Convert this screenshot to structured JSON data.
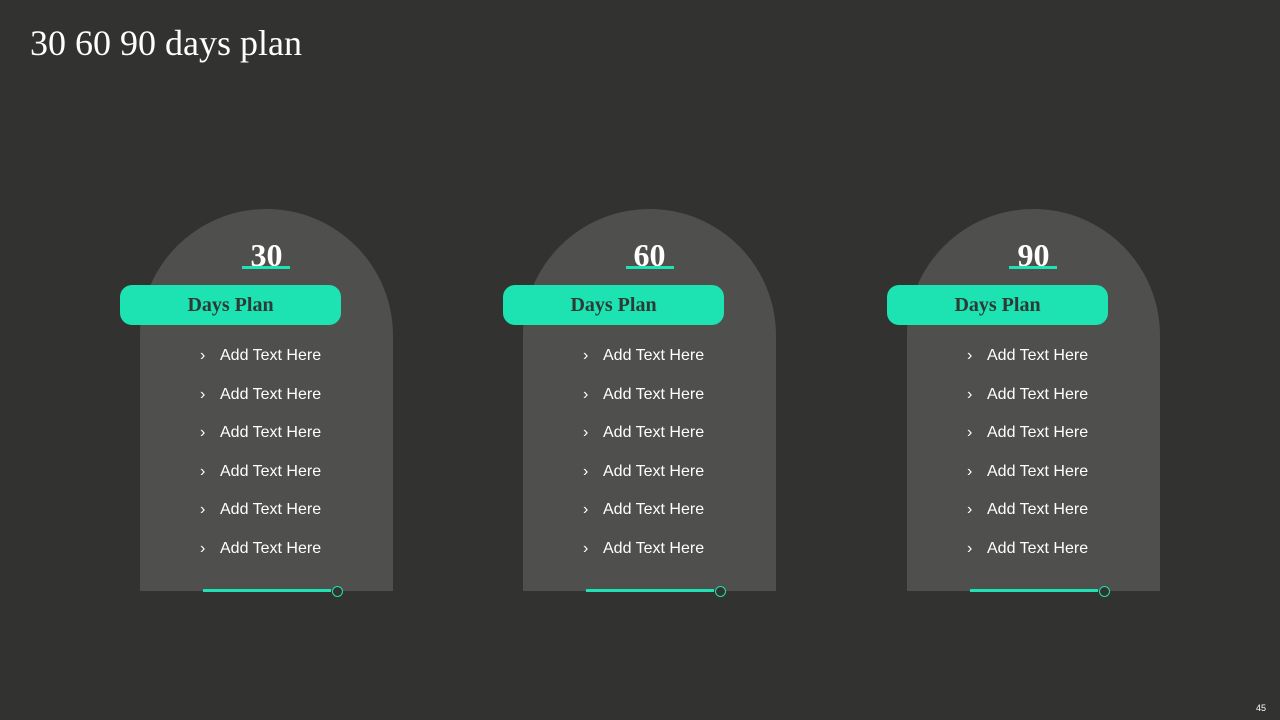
{
  "title": "30 60 90 days plan",
  "page_number": "45",
  "colors": {
    "background": "#323230",
    "card": "#4f4f4d",
    "accent": "#1de2b2",
    "pill_text": "#2d3a36"
  },
  "icons": {
    "bullet": "chevron-right-icon"
  },
  "cards": [
    {
      "number": "30",
      "label": "Days Plan",
      "items": [
        "Add Text Here",
        "Add Text Here",
        "Add Text Here",
        "Add Text Here",
        "Add Text Here",
        "Add Text Here"
      ]
    },
    {
      "number": "60",
      "label": "Days Plan",
      "items": [
        "Add Text Here",
        "Add Text Here",
        "Add Text Here",
        "Add Text Here",
        "Add Text Here",
        "Add Text Here"
      ]
    },
    {
      "number": "90",
      "label": "Days Plan",
      "items": [
        "Add Text Here",
        "Add Text Here",
        "Add Text Here",
        "Add Text Here",
        "Add Text Here",
        "Add Text Here"
      ]
    }
  ]
}
